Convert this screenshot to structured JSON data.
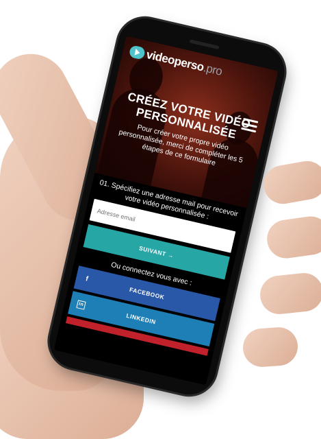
{
  "brand": {
    "part1": "video",
    "part2": "perso",
    "part3": ".pro"
  },
  "hero": {
    "title_line1": "CRÉEZ VOTRE VIDÉO",
    "title_line2": "PERSONNALISÉE",
    "subtitle": "Pour créer votre propre vidéo personnalisée, merci de compléter les 5 étapes de ce formulaire"
  },
  "form": {
    "step_label": "01. Spécifiez une adresse mail pour recevoir votre vidéo personnalisée :",
    "email_placeholder": "Adresse email",
    "next_label": "SUIVANT →"
  },
  "social": {
    "or_label": "Ou connectez vous avec :",
    "facebook_label": "FACEBOOK",
    "facebook_icon": "f",
    "linkedin_label": "LINKEDIN",
    "linkedin_icon": "in"
  },
  "colors": {
    "accent": "#27a6a6",
    "facebook": "#2a58a8",
    "linkedin": "#1d7fb6",
    "logo": "#4fc3c9"
  }
}
